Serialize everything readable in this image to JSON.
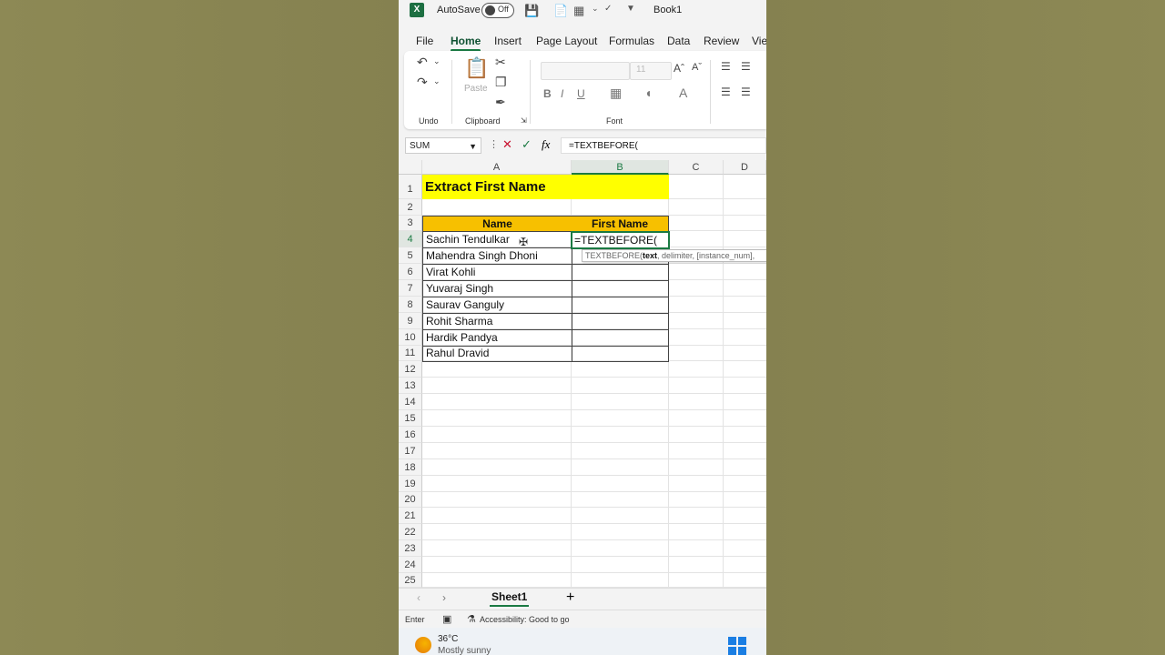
{
  "titlebar": {
    "autosave_label": "AutoSave",
    "autosave_state": "Off",
    "book_name": "Book1"
  },
  "ribbon_tabs": [
    "File",
    "Home",
    "Insert",
    "Page Layout",
    "Formulas",
    "Data",
    "Review",
    "Vie"
  ],
  "active_tab": "Home",
  "ribbon": {
    "undo_group": "Undo",
    "clipboard_group": "Clipboard",
    "paste_label": "Paste",
    "font_group": "Font",
    "font_size": "11"
  },
  "formula_bar": {
    "name_box": "SUM",
    "fx": "fx",
    "formula": "=TEXTBEFORE("
  },
  "columns": [
    "A",
    "B",
    "C",
    "D"
  ],
  "rows": [
    "1",
    "2",
    "3",
    "4",
    "5",
    "6",
    "7",
    "8",
    "9",
    "10",
    "11",
    "12",
    "13",
    "14",
    "15",
    "16",
    "17",
    "18",
    "19",
    "20",
    "21",
    "22",
    "23",
    "24",
    "25"
  ],
  "sheet": {
    "title": "Extract First Name",
    "header_name": "Name",
    "header_first_name": "First Name",
    "names": [
      "Sachin Tendulkar",
      "Mahendra Singh Dhoni",
      "Virat Kohli",
      "Yuvaraj Singh",
      "Saurav Ganguly",
      "Rohit Sharma",
      "Hardik Pandya",
      "Rahul Dravid"
    ],
    "active_cell_value": "=TEXTBEFORE("
  },
  "tooltip": {
    "fn": "TEXTBEFORE(",
    "arg_bold": "text",
    "rest": ", delimiter, [instance_num],"
  },
  "sheet_tabs": {
    "active": "Sheet1",
    "add": "+"
  },
  "status": {
    "mode": "Enter",
    "accessibility": "Accessibility: Good to go"
  },
  "taskbar": {
    "temperature": "36°C",
    "weather": "Mostly sunny"
  },
  "colors": {
    "excel_green": "#1b7a43",
    "title_fill": "#ffff00",
    "header_fill": "#f7c000",
    "background_olive": "#898451"
  }
}
